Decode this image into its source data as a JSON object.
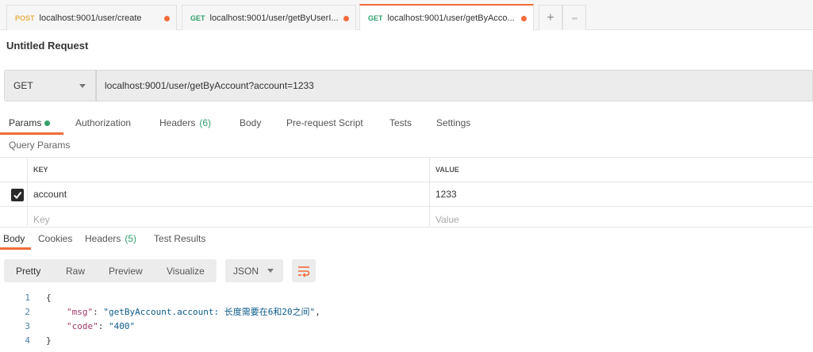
{
  "tabs": [
    {
      "method": "POST",
      "url": "localhost:9001/user/create",
      "active": false
    },
    {
      "method": "GET",
      "url": "localhost:9001/user/getByUserI...",
      "active": false
    },
    {
      "method": "GET",
      "url": "localhost:9001/user/getByAcco...",
      "active": true
    }
  ],
  "tab_controls": {
    "add_label": "+",
    "more_label": "◦◦◦"
  },
  "request": {
    "title": "Untitled Request",
    "method": "GET",
    "url": "localhost:9001/user/getByAccount?account=1233"
  },
  "request_tabs": {
    "params": "Params",
    "authorization": "Authorization",
    "headers": "Headers",
    "headers_count": "(6)",
    "body": "Body",
    "prerequest": "Pre-request Script",
    "tests": "Tests",
    "settings": "Settings"
  },
  "query_params": {
    "label": "Query Params",
    "key_header": "KEY",
    "value_header": "VALUE",
    "rows": [
      {
        "key": "account",
        "value": "1233",
        "checked": true
      }
    ],
    "key_placeholder": "Key",
    "value_placeholder": "Value"
  },
  "response_tabs": {
    "body": "Body",
    "cookies": "Cookies",
    "headers": "Headers",
    "headers_count": "(5)",
    "test_results": "Test Results"
  },
  "response_view": {
    "pretty": "Pretty",
    "raw": "Raw",
    "preview": "Preview",
    "visualize": "Visualize",
    "format": "JSON"
  },
  "response_body": {
    "line_numbers": [
      "1",
      "2",
      "3",
      "4"
    ],
    "open_brace": "{",
    "msg_key": "\"msg\"",
    "msg_value": "\"getByAccount.account: 长度需要在6和20之间\"",
    "code_key": "\"code\"",
    "code_value": "\"400\"",
    "close_brace": "}"
  },
  "colors": {
    "accent": "#f26b3a",
    "get_method": "#30a06b",
    "post_method": "#e8b14b"
  }
}
